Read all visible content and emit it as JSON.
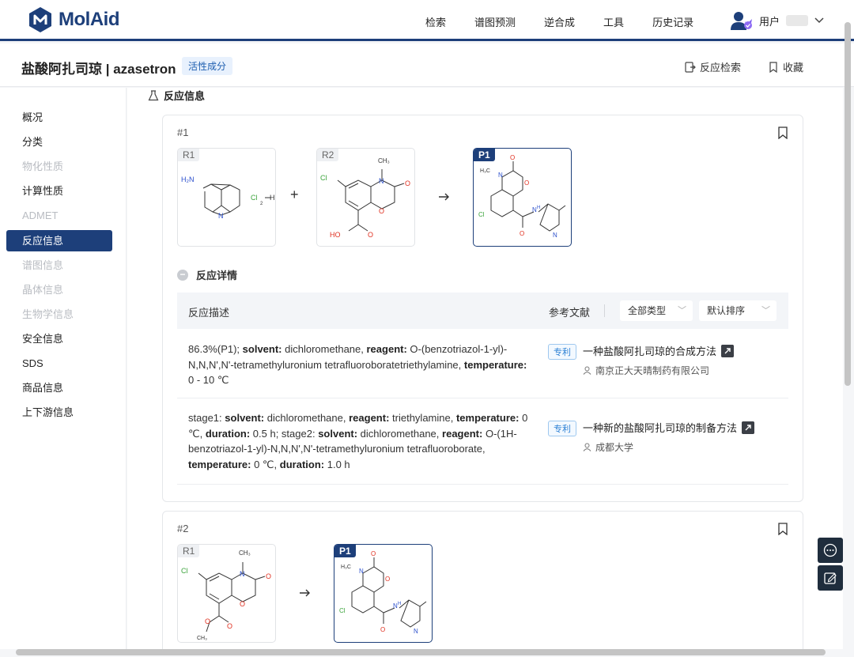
{
  "brand": {
    "name": "MolAid"
  },
  "nav": {
    "items": [
      "检索",
      "谱图预测",
      "逆合成",
      "工具",
      "历史记录"
    ]
  },
  "user": {
    "label": "用户"
  },
  "title": {
    "text": "盐酸阿扎司琼 | azasetron",
    "tag": "活性成分",
    "actions": [
      "反应检索",
      "收藏"
    ]
  },
  "sidebar": {
    "items": [
      {
        "label": "概况",
        "state": "normal"
      },
      {
        "label": "分类",
        "state": "normal"
      },
      {
        "label": "物化性质",
        "state": "disabled"
      },
      {
        "label": "计算性质",
        "state": "normal"
      },
      {
        "label": "ADMET",
        "state": "disabled"
      },
      {
        "label": "反应信息",
        "state": "active"
      },
      {
        "label": "谱图信息",
        "state": "disabled"
      },
      {
        "label": "晶体信息",
        "state": "disabled"
      },
      {
        "label": "生物学信息",
        "state": "disabled"
      },
      {
        "label": "安全信息",
        "state": "normal"
      },
      {
        "label": "SDS",
        "state": "normal"
      },
      {
        "label": "商品信息",
        "state": "normal"
      },
      {
        "label": "上下游信息",
        "state": "normal"
      }
    ]
  },
  "section": {
    "title": "反应信息"
  },
  "reactions": [
    {
      "num": "#1",
      "r1": {
        "tag": "R1",
        "labels": [
          "H₂N",
          "N",
          "Cl",
          "H",
          "2"
        ]
      },
      "r2": {
        "tag": "R2",
        "labels": [
          "CH₃",
          "N",
          "O",
          "Cl",
          "O",
          "HO",
          "O"
        ]
      },
      "p1": {
        "tag": "P1",
        "labels": [
          "O",
          "H₃C",
          "N",
          "O",
          "Cl",
          "O",
          "N",
          "H",
          "N"
        ]
      },
      "detail_label": "反应详情",
      "table": {
        "col_desc": "反应描述",
        "col_ref": "参考文献",
        "filter_type": "全部类型",
        "filter_sort": "默认排序"
      },
      "rows": [
        {
          "yield": "86.3%(P1);",
          "k1": "solvent:",
          "v1": "dichloromethane,",
          "k2": "reagent:",
          "v2": "O-(benzotriazol-1-yl)-N,N,N',N'-tetramethyluronium tetrafluoroboratetriethylamine,",
          "k3": "temperature:",
          "v3": "0 - 10 ℃",
          "ref_tag": "专利",
          "ref_title": "一种盐酸阿扎司琼的合成方法",
          "ref_org": "南京正大天晴制药有限公司"
        },
        {
          "yield": "stage1:",
          "k1": "solvent:",
          "v1": "dichloromethane,",
          "k2": "reagent:",
          "v2": "triethylamine,",
          "k3": "temperature:",
          "v3": "0 ℃,",
          "k4": "duration:",
          "v4": "0.5 h; stage2:",
          "k5": "solvent:",
          "v5": "dichloromethane,",
          "k6": "reagent:",
          "v6": "O-(1H-benzotriazol-1-yl)-N,N,N',N'-tetramethyluronium tetrafluoroborate,",
          "k7": "temperature:",
          "v7": "0 ℃,",
          "k8": "duration:",
          "v8": "1.0 h",
          "ref_tag": "专利",
          "ref_title": "一种新的盐酸阿扎司琼的制备方法",
          "ref_org": "成都大学"
        }
      ]
    },
    {
      "num": "#2",
      "r1": {
        "tag": "R1",
        "labels": [
          "CH₃",
          "N",
          "O",
          "Cl",
          "O",
          "O",
          "O",
          "CH₃"
        ]
      },
      "p1": {
        "tag": "P1",
        "labels": [
          "O",
          "H₃C",
          "N",
          "O",
          "Cl",
          "O",
          "N",
          "H",
          "N"
        ]
      }
    }
  ],
  "colors": {
    "brand": "#1d3f7a",
    "patent": "#2a7fd4",
    "chlorine": "#3aa33a",
    "oxygen": "#e03020",
    "nitrogen": "#2b4fcc"
  }
}
